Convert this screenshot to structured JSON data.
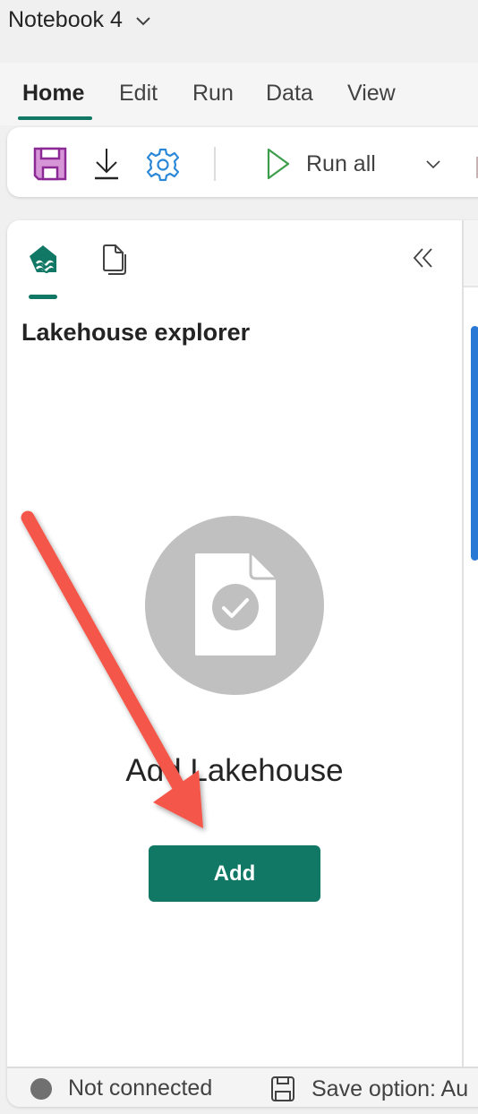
{
  "window": {
    "title": "Notebook 4"
  },
  "ribbon": {
    "tabs": [
      {
        "label": "Home",
        "active": true
      },
      {
        "label": "Edit",
        "active": false
      },
      {
        "label": "Run",
        "active": false
      },
      {
        "label": "Data",
        "active": false
      },
      {
        "label": "View",
        "active": false
      }
    ],
    "accent_color": "#117865"
  },
  "toolbar": {
    "icons": [
      "save-icon",
      "download-icon",
      "settings-icon"
    ],
    "run_all_label": "Run all",
    "icon_colors": {
      "save": "#d695d6",
      "settings": "#2b88d8",
      "run": "#3c9e4a"
    }
  },
  "explorer": {
    "tabs": [
      "lakehouse-icon",
      "resources-icon"
    ],
    "title": "Lakehouse explorer",
    "empty_state": {
      "heading": "Add Lakehouse",
      "button_label": "Add"
    }
  },
  "statusbar": {
    "connection_status": "Not connected",
    "save_option": "Save option: Au"
  },
  "annotation": {
    "arrow_color": "#f4574a",
    "target": "Add"
  }
}
